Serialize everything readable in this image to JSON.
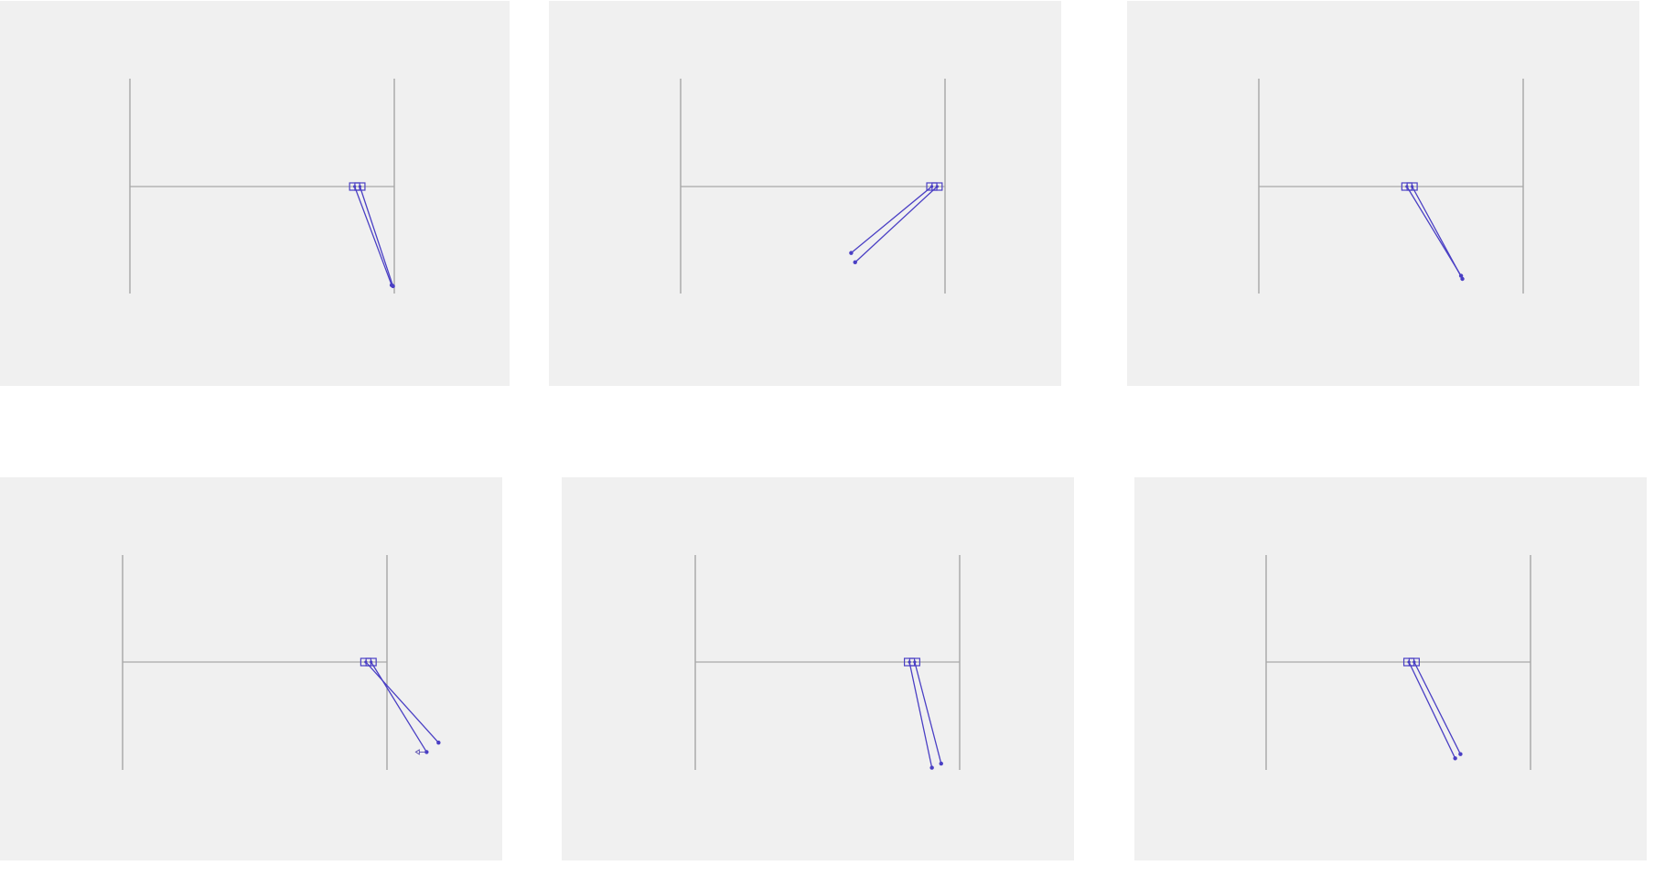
{
  "colors": {
    "panel_background": "#f0f0f0",
    "page_background": "#ffffff",
    "walls": "#9a9a9a",
    "track": "#a8a8a8",
    "pendulum": "#4a3fc4"
  },
  "diagram": {
    "type": "double-cart-pole frames",
    "track_range": [
      -1,
      1
    ],
    "frames": [
      {
        "carts": [
          0.7,
          0.74
        ],
        "bobs": [
          [
            0.98,
            0.95
          ],
          [
            0.99,
            0.96
          ]
        ]
      },
      {
        "carts": [
          0.9,
          0.94
        ],
        "bobs": [
          [
            0.29,
            0.64
          ],
          [
            0.32,
            0.73
          ]
        ]
      },
      {
        "carts": [
          0.12,
          0.16
        ],
        "bobs": [
          [
            0.53,
            0.86
          ],
          [
            0.54,
            0.89
          ]
        ]
      },
      {
        "carts": [
          0.84,
          0.88
        ],
        "bobs": [
          [
            1.39,
            0.77
          ],
          [
            1.3,
            0.86
          ]
        ],
        "marker": true
      },
      {
        "carts": [
          0.62,
          0.66
        ],
        "bobs": [
          [
            0.79,
            1.01
          ],
          [
            0.86,
            0.97
          ]
        ]
      },
      {
        "carts": [
          0.08,
          0.12
        ],
        "bobs": [
          [
            0.43,
            0.92
          ],
          [
            0.47,
            0.88
          ]
        ]
      }
    ]
  }
}
